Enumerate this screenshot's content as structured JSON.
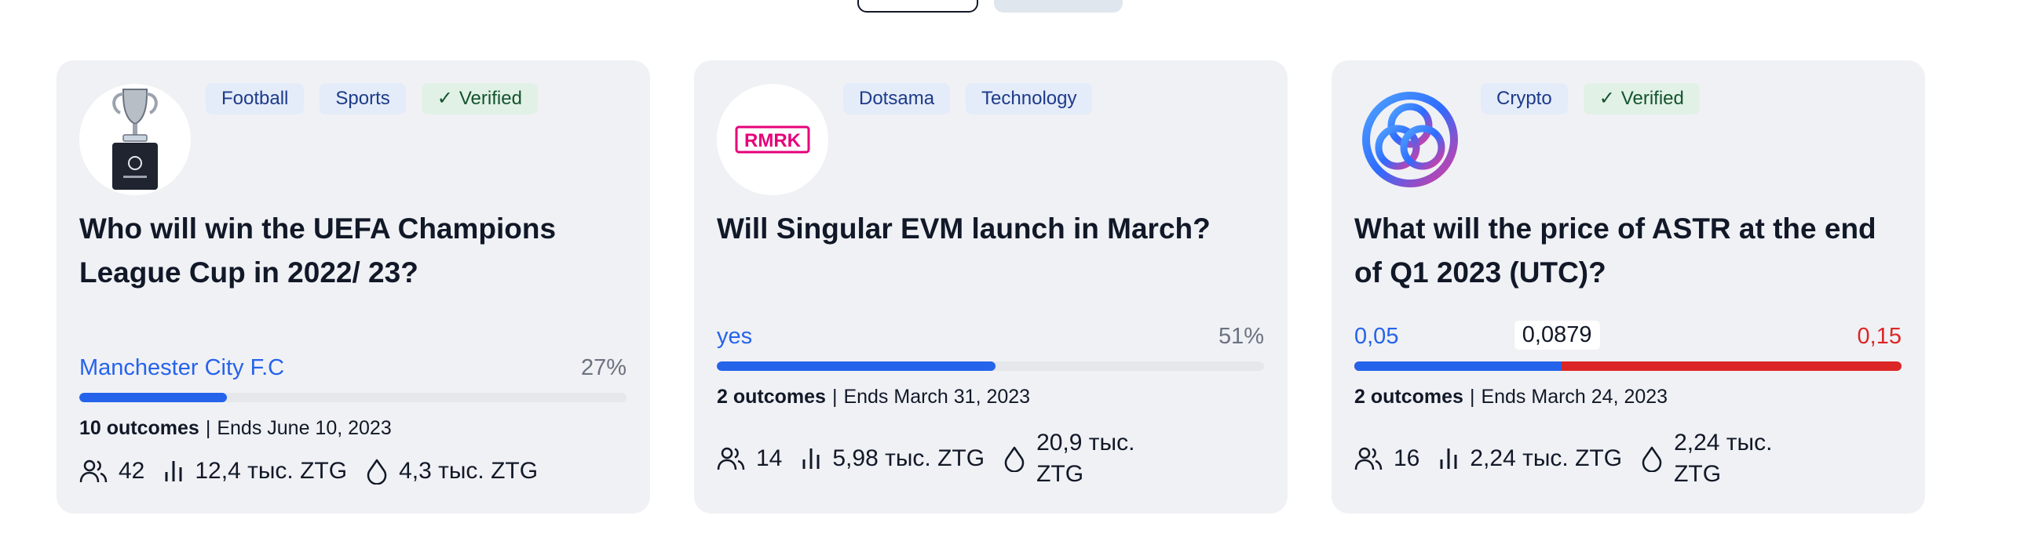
{
  "cards": [
    {
      "tags": [
        "Football",
        "Sports"
      ],
      "verified": "Verified",
      "title": "Who will win the UEFA Champions League Cup in 2022/ 23?",
      "leading_outcome": "Manchester City F.C",
      "leading_percent": "27%",
      "leading_share": 0.27,
      "outcomes_count": "10 outcomes",
      "ends": "Ends June 10, 2023",
      "traders": "42",
      "volume": "12,4 тыс. ZTG",
      "liquidity": "4,3 тыс. ZTG"
    },
    {
      "avatar_text": "RMRK",
      "tags": [
        "Dotsama",
        "Technology"
      ],
      "title": "Will Singular EVM launch in March?",
      "leading_outcome": "yes",
      "leading_percent": "51%",
      "leading_share": 0.51,
      "outcomes_count": "2 outcomes",
      "ends": "Ends March 31, 2023",
      "traders": "14",
      "volume": "5,98 тыс. ZTG",
      "liquidity": "20,9 тыс. ZTG"
    },
    {
      "tags": [
        "Crypto"
      ],
      "verified": "Verified",
      "title": "What will the price of ASTR at the end of Q1 2023 (UTC)?",
      "scalar_min": "0,05",
      "scalar_current": "0,0879",
      "scalar_max": "0,15",
      "scalar_position": 0.379,
      "outcomes_count": "2 outcomes",
      "ends": "Ends March 24, 2023",
      "traders": "16",
      "volume": "2,24 тыс. ZTG",
      "liquidity": "2,24 тыс. ZTG"
    }
  ],
  "colors": {
    "card_bg": "#f0f1f5",
    "accent_blue": "#2563eb",
    "accent_red": "#dc2626",
    "tag_bg": "#e3ecf8",
    "verified_bg": "#e1f1e6"
  },
  "icons": {
    "traders": "users-icon",
    "volume": "bar-chart-icon",
    "liquidity": "droplet-icon",
    "verified": "check-icon"
  }
}
